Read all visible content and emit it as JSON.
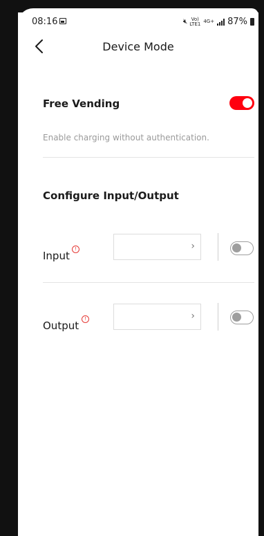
{
  "status_bar": {
    "time": "08:16",
    "volte_top": "Vo)",
    "volte_bottom": "LTE1",
    "network": "4G+",
    "battery": "87%"
  },
  "header": {
    "title": "Device Mode"
  },
  "free_vending": {
    "label": "Free Vending",
    "description": "Enable charging without authentication.",
    "enabled": true
  },
  "configure": {
    "title": "Configure Input/Output",
    "rows": [
      {
        "label": "Input",
        "info_icon": "!",
        "value": "",
        "enabled": false
      },
      {
        "label": "Output",
        "info_icon": "!",
        "value": "",
        "enabled": false
      }
    ]
  },
  "colors": {
    "accent": "#ff000f",
    "warning": "#e53935",
    "toggle_off": "#9e9e9e"
  },
  "icons": {
    "back": "chevron-left-icon",
    "select_arrow": "chevron-right-icon",
    "info": "exclamation-circle-icon"
  }
}
